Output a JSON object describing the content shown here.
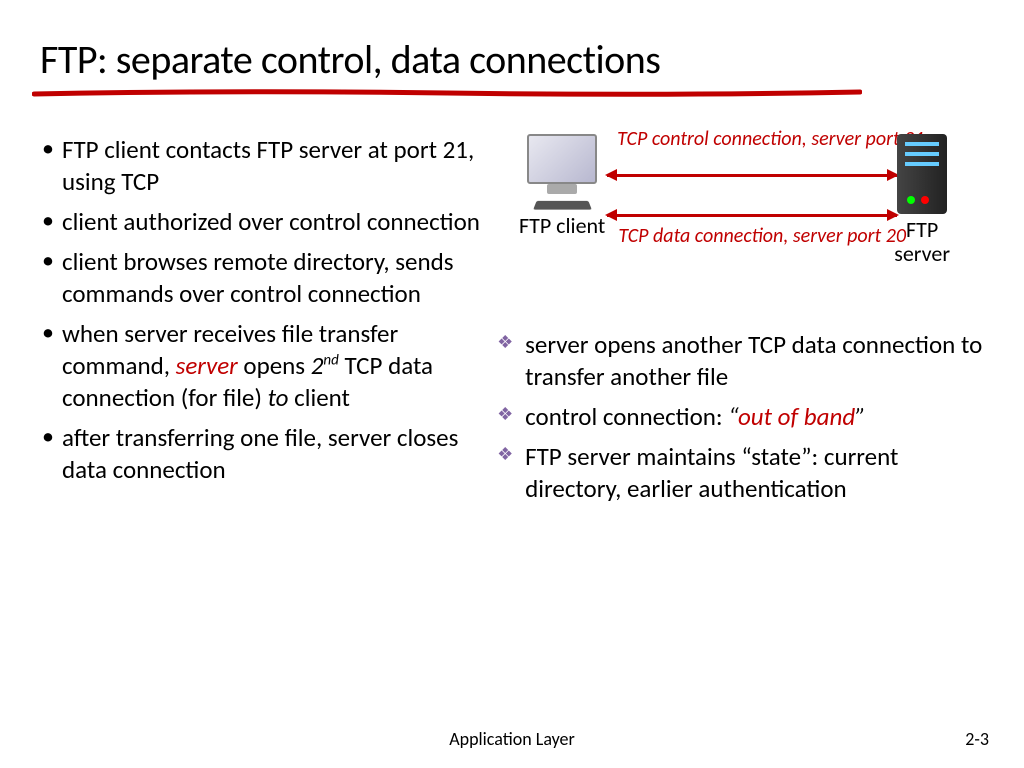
{
  "title": "FTP: separate control, data connections",
  "left_bullets": {
    "b1": "FTP client contacts FTP server at port 21, using TCP",
    "b2": "client authorized over control connection",
    "b3": "client browses remote directory, sends commands over control connection",
    "b4_pre": "when server receives file transfer command, ",
    "b4_server": "server",
    "b4_mid": " opens ",
    "b4_2": "2",
    "b4_nd": "nd",
    "b4_post1": " TCP data connection (for file) ",
    "b4_to": "to",
    "b4_post2": " client",
    "b5": "after transferring one file, server closes data connection"
  },
  "diagram": {
    "client_label": "FTP client",
    "server_label": "FTP server",
    "top_arrow": "TCP control connection, server port 21",
    "bottom_arrow": "TCP data connection, server port 20"
  },
  "right_bullets": {
    "r1": "server opens another TCP data connection to transfer another file",
    "r2_pre": "control connection: ",
    "r2_q1": "“",
    "r2_red": "out of band",
    "r2_q2": "”",
    "r3": "FTP server maintains “state”: current directory, earlier authentication"
  },
  "footer": {
    "center": "Application Layer",
    "right": "2-3"
  }
}
